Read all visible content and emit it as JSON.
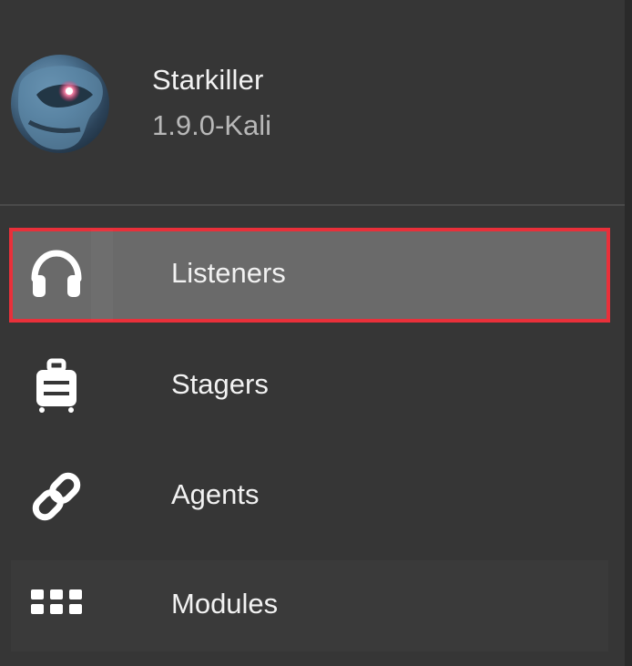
{
  "header": {
    "title": "Starkiller",
    "version": "1.9.0-Kali",
    "avatar_icon": "starkiller-helmet-icon"
  },
  "nav": {
    "items": [
      {
        "label": "Listeners",
        "icon": "headphones-icon",
        "active": true
      },
      {
        "label": "Stagers",
        "icon": "luggage-icon",
        "active": false
      },
      {
        "label": "Agents",
        "icon": "link-icon",
        "active": false
      },
      {
        "label": "Modules",
        "icon": "apps-grid-icon",
        "active": false
      }
    ]
  },
  "colors": {
    "background": "#363636",
    "active_item": "#6a6a6a",
    "highlight_border": "#e8303a",
    "text": "#f2f2f2",
    "muted_text": "#b8b8b8"
  }
}
